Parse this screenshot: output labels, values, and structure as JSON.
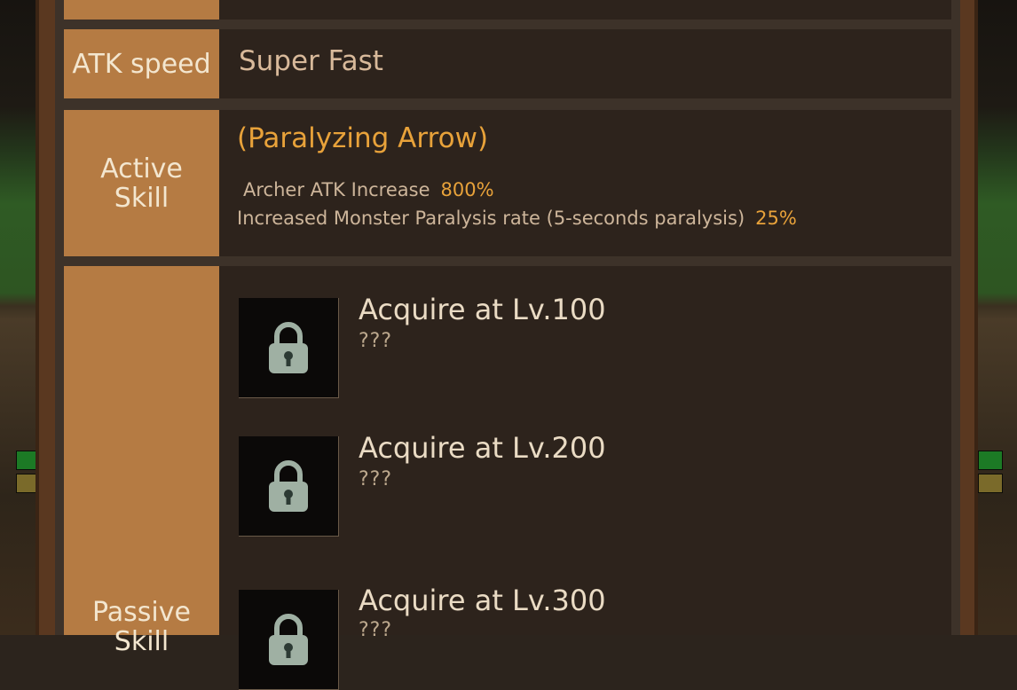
{
  "stats": {
    "atk_speed_label": "ATK speed",
    "atk_speed_value": "Super Fast"
  },
  "active_skill": {
    "label": "Active Skill",
    "name": "(Paralyzing Arrow)",
    "effects": [
      {
        "text": "Archer ATK Increase",
        "value": "800%"
      },
      {
        "text": "Increased Monster Paralysis rate (5-seconds paralysis)",
        "value": "25%"
      }
    ]
  },
  "passive_skill": {
    "label": "Passive Skill",
    "slots": [
      {
        "title": "Acquire at Lv.100",
        "desc": "???",
        "icon": "lock-icon"
      },
      {
        "title": "Acquire at Lv.200",
        "desc": "???",
        "icon": "lock-icon"
      },
      {
        "title": "Acquire at Lv.300",
        "desc": "???",
        "icon": "lock-icon"
      }
    ]
  },
  "colors": {
    "label_bg": "#b57b43",
    "highlight": "#e8a23a",
    "content_bg": "#2d231c"
  }
}
